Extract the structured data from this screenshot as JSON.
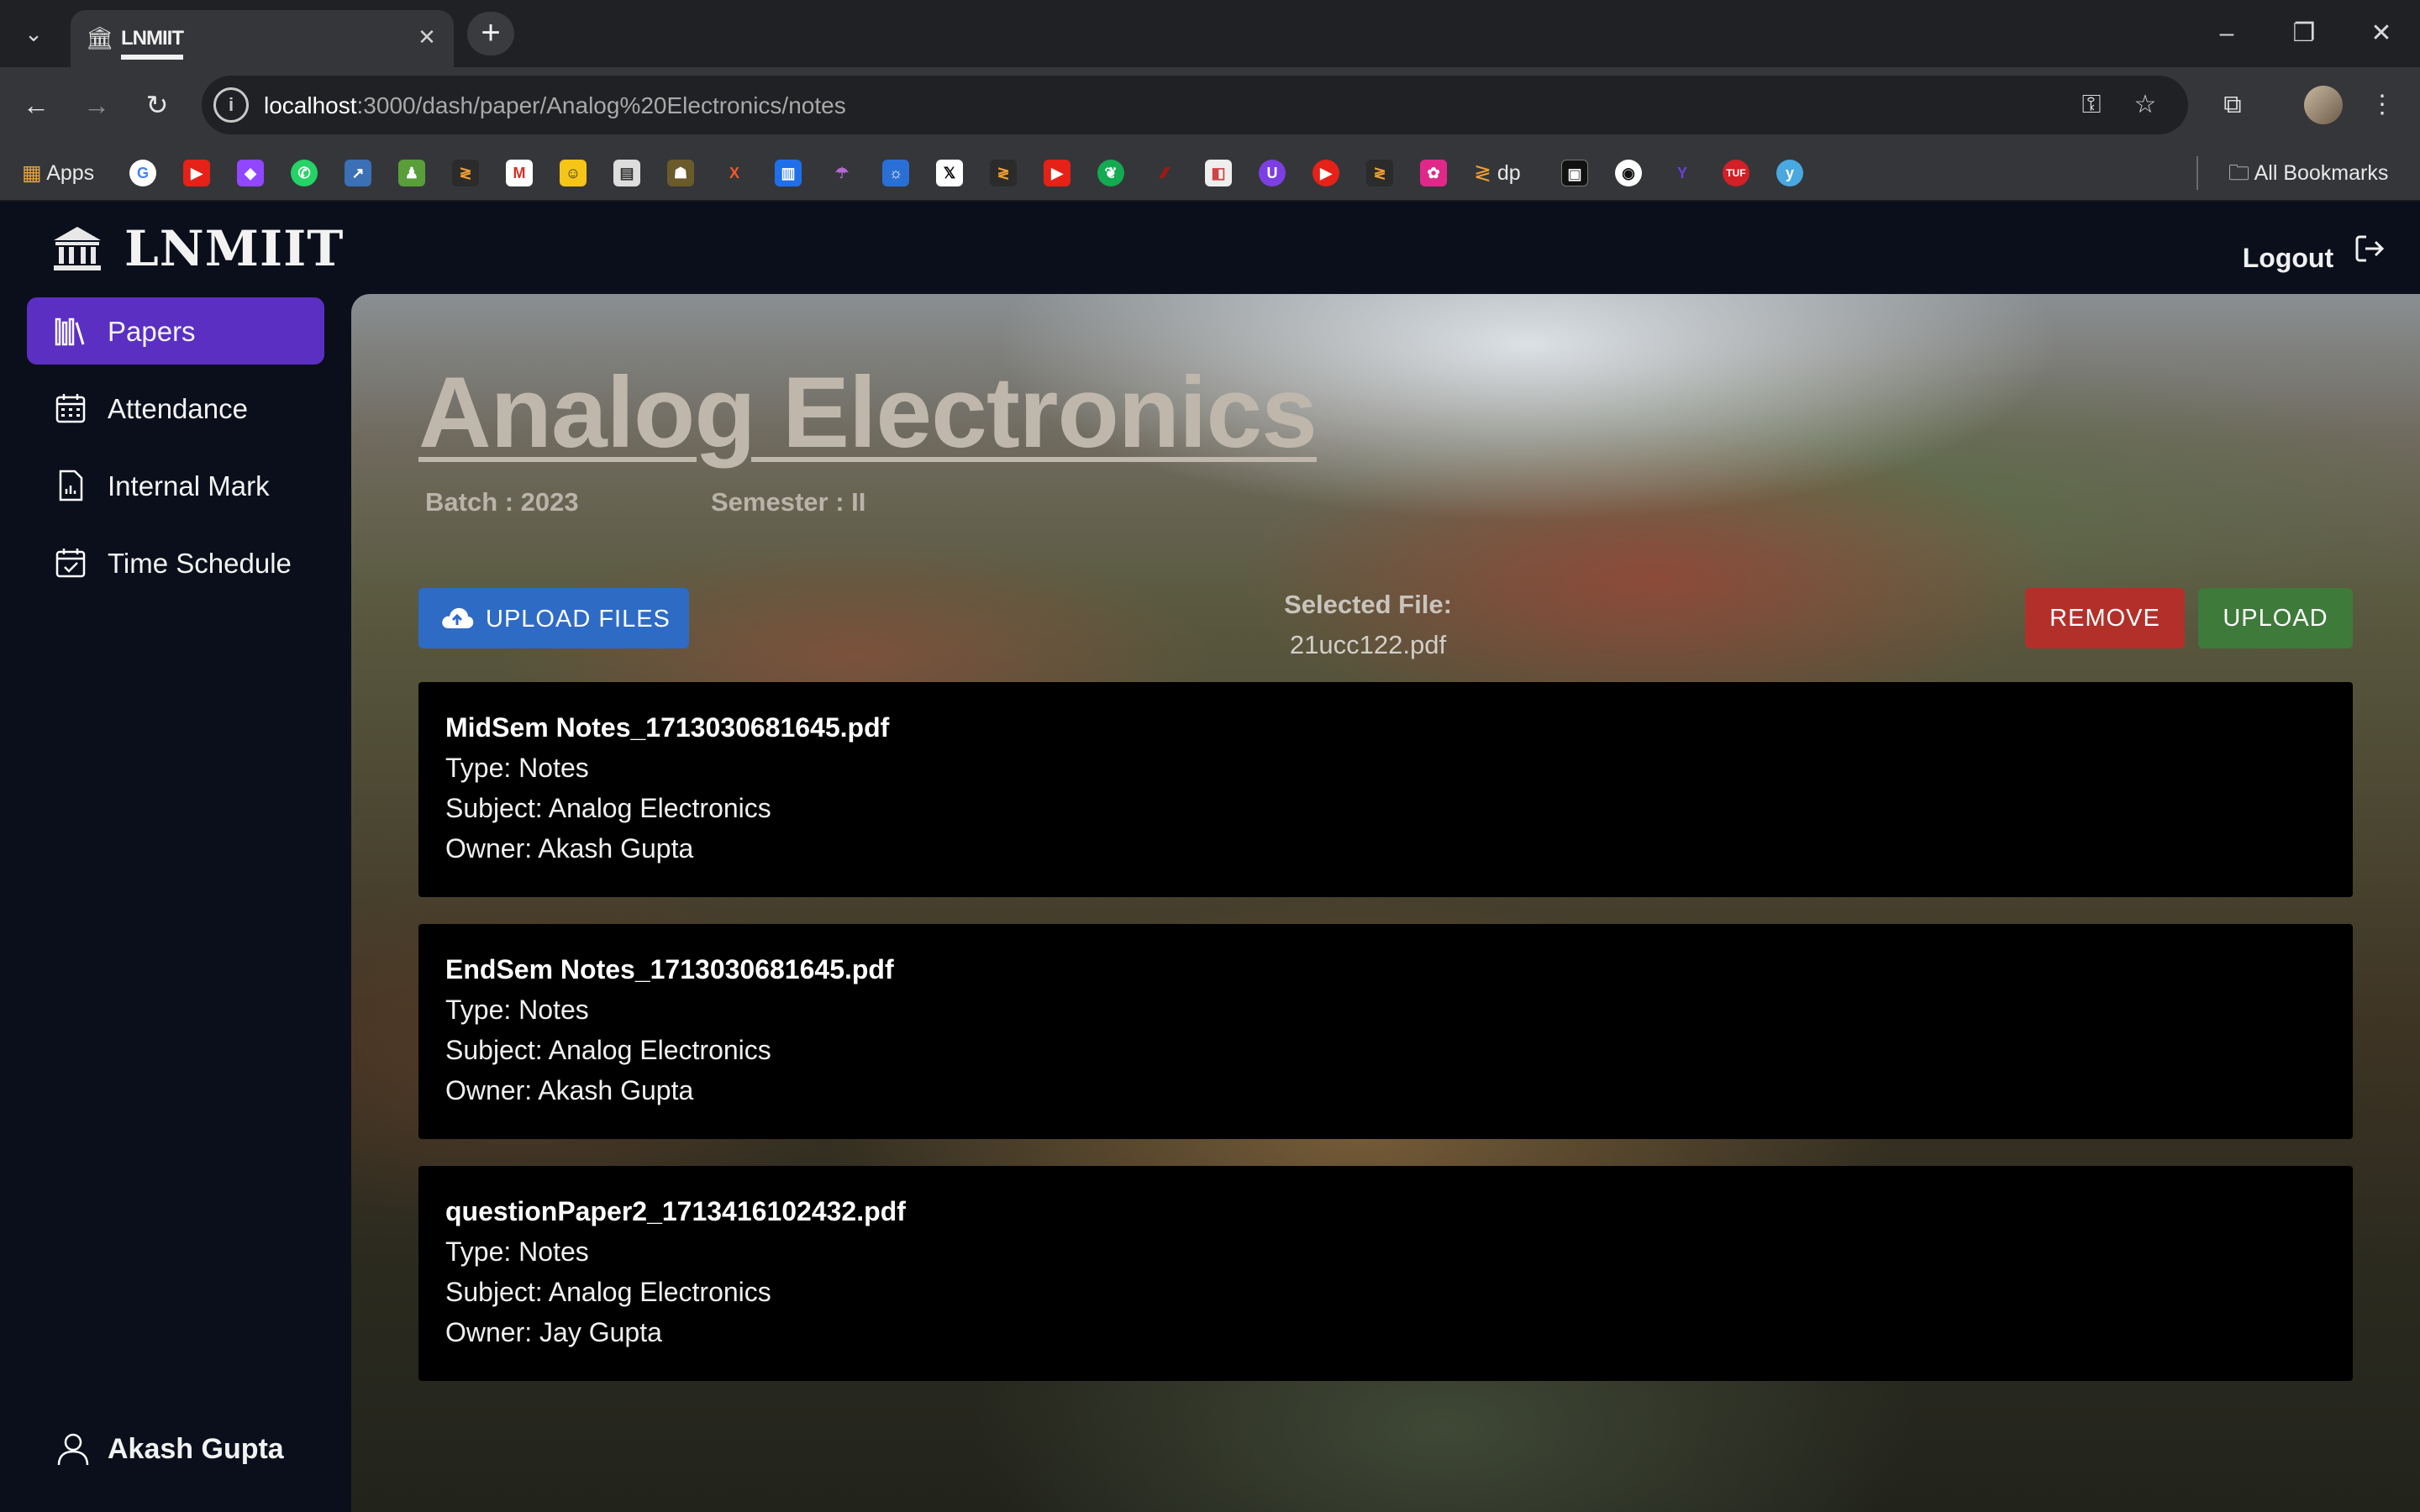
{
  "browser": {
    "tab_title": "LNMIIT",
    "url_host": "localhost",
    "url_rest": ":3000/dash/paper/Analog%20Electronics/notes",
    "bookmarks": {
      "apps_label": "Apps",
      "dp_label": "dp",
      "all_bookmarks_label": "All Bookmarks"
    }
  },
  "app": {
    "brand": "LNMIIT",
    "logout_label": "Logout",
    "sidebar": {
      "items": [
        {
          "label": "Papers",
          "active": true
        },
        {
          "label": "Attendance",
          "active": false
        },
        {
          "label": "Internal Mark",
          "active": false
        },
        {
          "label": "Time Schedule",
          "active": false
        }
      ],
      "user_name": "Akash Gupta"
    },
    "main": {
      "title": "Analog Electronics",
      "batch": "Batch : 2023",
      "semester": "Semester : II",
      "upload_files_label": "UPLOAD FILES",
      "selected_file_heading": "Selected File:",
      "selected_file_name": "21ucc122.pdf",
      "remove_label": "REMOVE",
      "upload_label": "UPLOAD",
      "files": [
        {
          "name": "MidSem Notes_1713030681645.pdf",
          "type": "Type: Notes",
          "subject": "Subject: Analog Electronics",
          "owner": "Owner: Akash Gupta"
        },
        {
          "name": "EndSem Notes_1713030681645.pdf",
          "type": "Type: Notes",
          "subject": "Subject: Analog Electronics",
          "owner": "Owner: Akash Gupta"
        },
        {
          "name": "questionPaper2_1713416102432.pdf",
          "type": "Type: Notes",
          "subject": "Subject: Analog Electronics",
          "owner": "Owner: Jay Gupta"
        }
      ]
    }
  },
  "colors": {
    "accent": "#5b2fc2",
    "upload_files_button": "#2e6bc4",
    "remove_button": "#b3302a",
    "upload_button": "#3e7a3a"
  }
}
